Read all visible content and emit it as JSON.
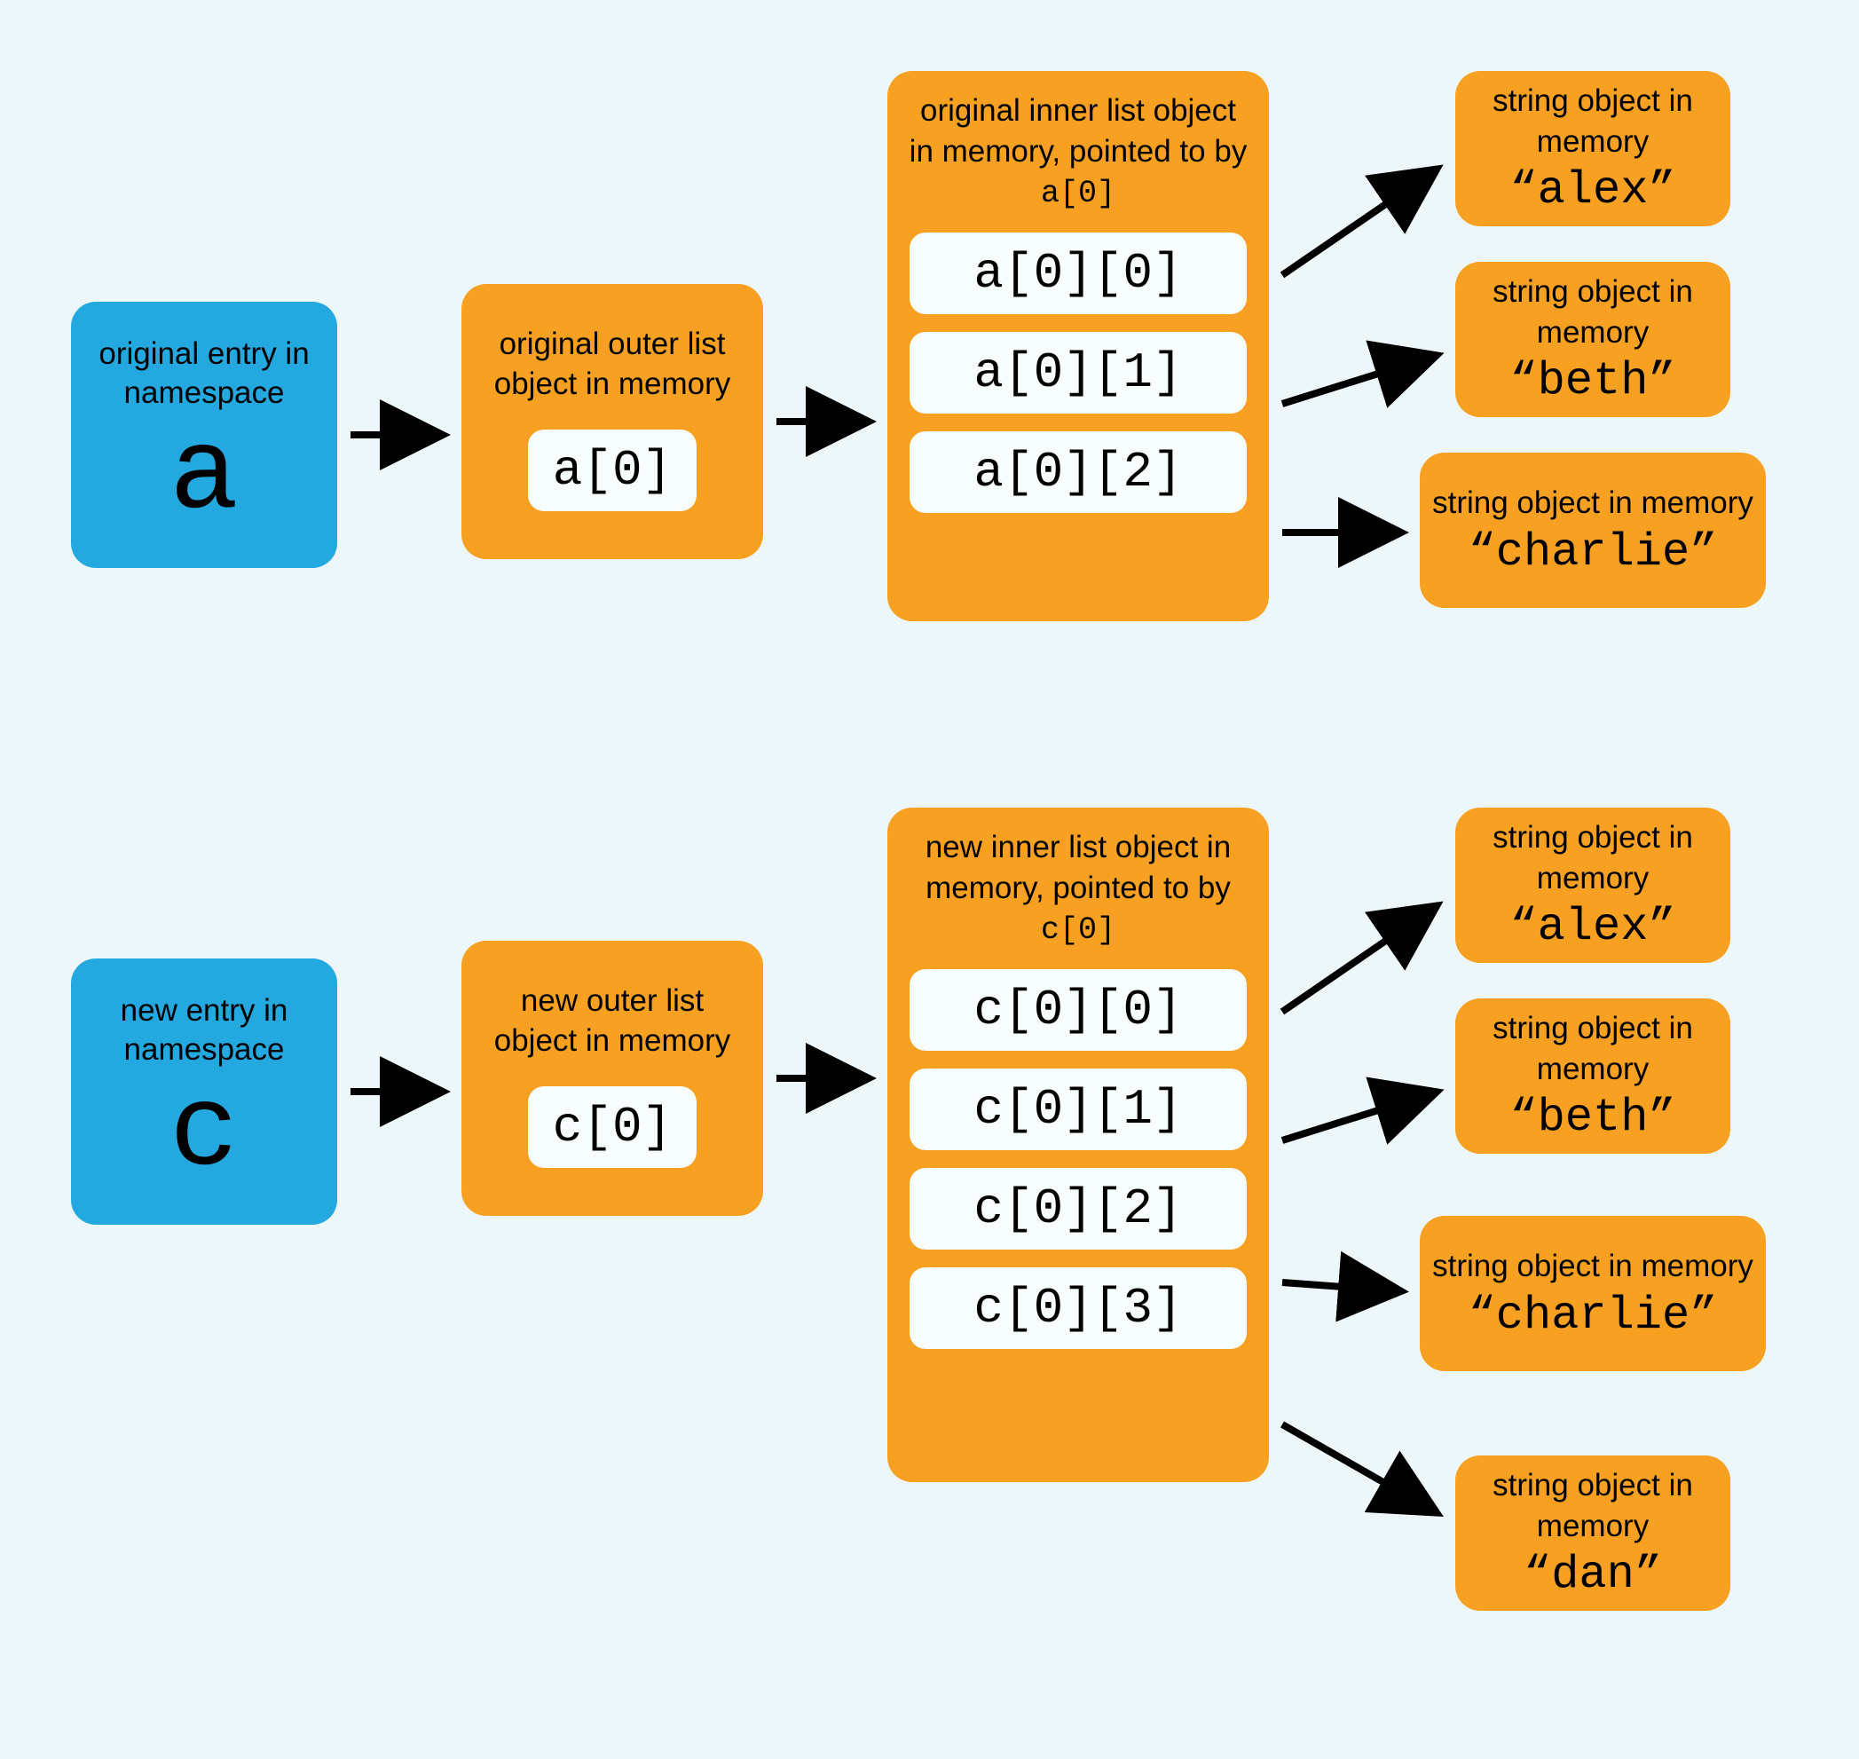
{
  "namespace_a": {
    "label": "original entry in namespace",
    "var": "a"
  },
  "namespace_c": {
    "label": "new entry in namespace",
    "var": "c"
  },
  "outer_a": {
    "label": "original outer list object in memory",
    "entry": "a[0]"
  },
  "outer_c": {
    "label": "new outer list object in memory",
    "entry": "c[0]"
  },
  "inner_a": {
    "label_prefix": "original inner list object in memory, pointed to by ",
    "label_code": "a[0]",
    "items": [
      "a[0][0]",
      "a[0][1]",
      "a[0][2]"
    ]
  },
  "inner_c": {
    "label_prefix": "new inner list object in memory, pointed to by ",
    "label_code": "c[0]",
    "items": [
      "c[0][0]",
      "c[0][1]",
      "c[0][2]",
      "c[0][3]"
    ]
  },
  "string_label": "string object in memory",
  "strings_a": [
    "alex",
    "beth",
    "charlie"
  ],
  "strings_c": [
    "alex",
    "beth",
    "charlie",
    "dan"
  ]
}
